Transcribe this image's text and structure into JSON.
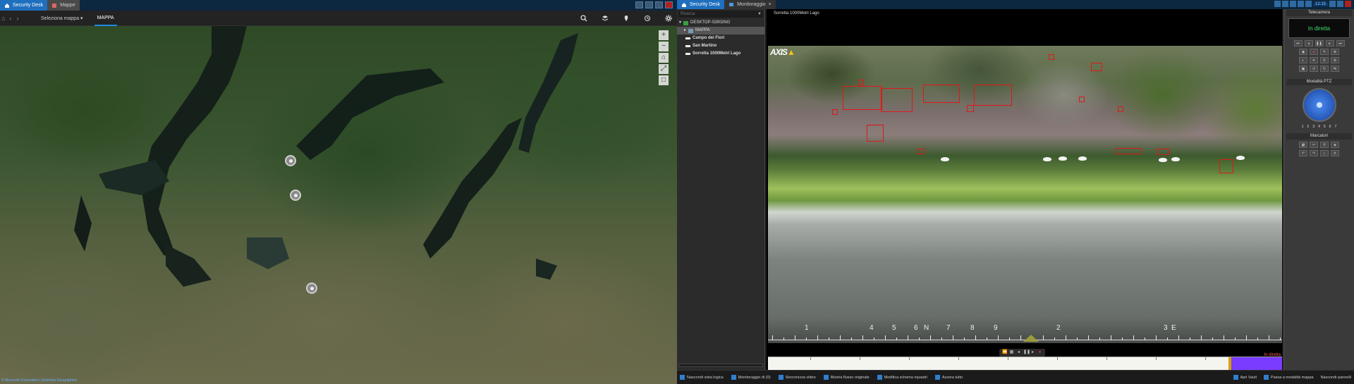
{
  "left_window": {
    "tabs": [
      {
        "label": "Security Desk",
        "active": true
      },
      {
        "label": "Mappe",
        "active": false
      }
    ],
    "toolbar": {
      "map_selector": "Seleziona mappa",
      "tab": "MAPPA"
    },
    "toolbar_icons": [
      "search-icon",
      "layers-icon",
      "marker-icon",
      "history-icon",
      "settings-icon"
    ],
    "map": {
      "zoom_controls": [
        "+",
        "−",
        "⌂",
        "⤢",
        "□"
      ],
      "attribution": "© Microsoft Corporation | Earthstar Geographics"
    }
  },
  "right_window": {
    "tabs": [
      {
        "label": "Security Desk",
        "active": true
      },
      {
        "label": "Monitoraggio",
        "active": false
      }
    ],
    "tray_time": "12:15",
    "tree": {
      "search_placeholder": "Ricerca",
      "items": [
        {
          "label": "DESKTOP-02802NG",
          "level": 0
        },
        {
          "label": "MAPPA",
          "level": 1,
          "selected": true
        },
        {
          "label": "Campo dei Fiori",
          "level": 2
        },
        {
          "label": "San Martino",
          "level": 2
        },
        {
          "label": "Sorretta 1000Metri Lago",
          "level": 2
        }
      ]
    },
    "video": {
      "title": "Sorretta 1000Metri Lago",
      "logo": "AXIS",
      "ruler_labels": [
        "1",
        "4",
        "5",
        "6",
        "N",
        "7",
        "8",
        "9",
        "2",
        "3",
        "E"
      ],
      "timeline_live": "In diretta"
    },
    "ptz": {
      "header": "Telecamera",
      "live_label": "In diretta",
      "ptz_header": "Modalità PTZ",
      "presets": [
        "1",
        "2",
        "3",
        "4",
        "5",
        "6",
        "7"
      ],
      "bookmarks_header": "Marcatori"
    },
    "status": [
      {
        "label": "Nascondi vista logica"
      },
      {
        "label": "Monitoraggio di (0)"
      },
      {
        "label": "Sincronizza video"
      },
      {
        "label": "Mostra flusso originale"
      },
      {
        "label": "Modifica schema riquadri"
      },
      {
        "label": "Azzera tutto"
      }
    ],
    "status_right": [
      "Apri Vault",
      "Passa a modalità mappa",
      "Nascondi pannelli"
    ]
  },
  "colors": {
    "tab_active": "#1f6fbf",
    "titlebar": "#0c2740",
    "live_green": "#3fe06a",
    "detection_red": "#e01818",
    "timeline_recording": "#7a3cff"
  }
}
